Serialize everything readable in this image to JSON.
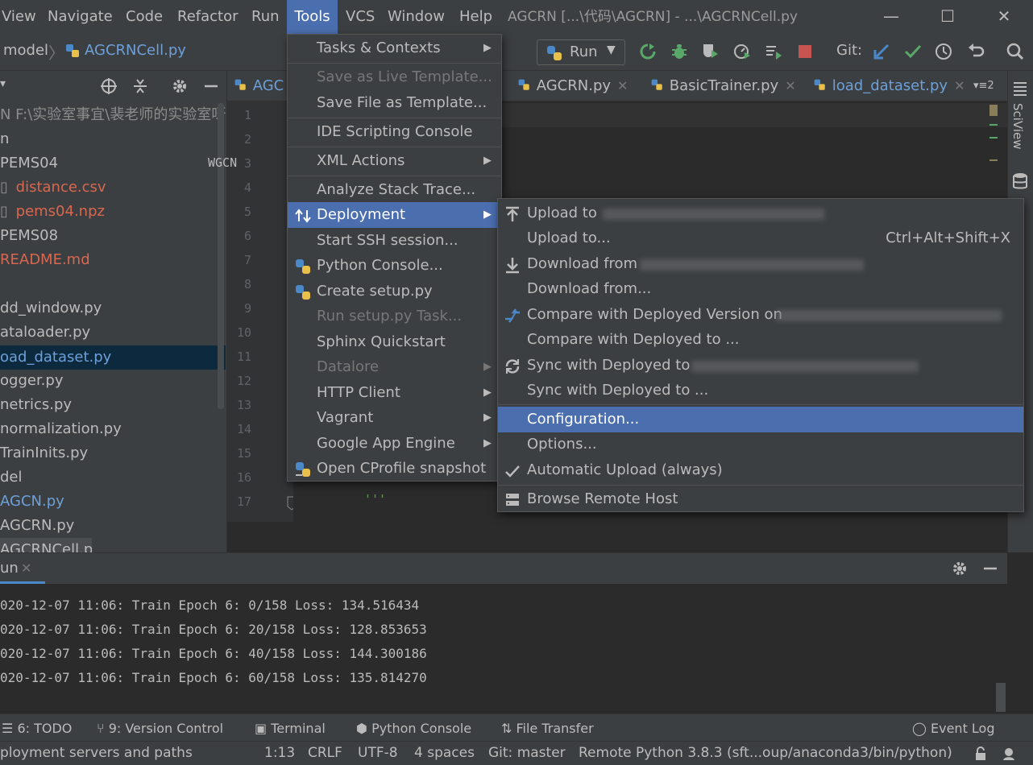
{
  "menubar": {
    "items": [
      "View",
      "Navigate",
      "Code",
      "Refactor",
      "Run",
      "Tools",
      "VCS",
      "Window",
      "Help"
    ],
    "active": "Tools",
    "window_title": "AGCRN [...\\代码\\AGCRN] - ...\\AGCRNCell.py",
    "controls": {
      "minimize": "—",
      "maximize": "☐",
      "close": "✕"
    }
  },
  "navbar": {
    "breadcrumb_model": "model",
    "breadcrumb_file": "AGCRNCell.py",
    "run_config": "Run",
    "git_label": "Git:"
  },
  "project": {
    "rows": [
      {
        "text": "N  F:\\实验室事宜\\裴老师的实验室呀\\",
        "color": "gray"
      },
      {
        "text": "n",
        "color": "def"
      },
      {
        "text": "PEMS04",
        "color": "def"
      },
      {
        "text": "distance.csv",
        "color": "red"
      },
      {
        "text": "pems04.npz",
        "color": "red"
      },
      {
        "text": "PEMS08",
        "color": "def"
      },
      {
        "text": "README.md",
        "color": "red"
      },
      {
        "text": "",
        "color": "def"
      },
      {
        "text": "dd_window.py",
        "color": "def"
      },
      {
        "text": "ataloader.py",
        "color": "def"
      },
      {
        "text": "oad_dataset.py",
        "color": "blue"
      },
      {
        "text": "ogger.py",
        "color": "def"
      },
      {
        "text": "netrics.py",
        "color": "def"
      },
      {
        "text": "normalization.py",
        "color": "def"
      },
      {
        "text": "TrainInits.py",
        "color": "def"
      },
      {
        "text": "del",
        "color": "def"
      },
      {
        "text": "AGCN.py",
        "color": "blue"
      },
      {
        "text": "AGCRN.py",
        "color": "def"
      },
      {
        "text": "AGCRNCell.py",
        "color": "def"
      }
    ]
  },
  "editor_tabs": [
    {
      "label": "AGC",
      "color": "blue"
    },
    {
      "label": "AGCRN.py",
      "color": "def"
    },
    {
      "label": "BasicTrainer.py",
      "color": "def"
    },
    {
      "label": "load_dataset.py",
      "color": "blue"
    }
  ],
  "tabs_overflow": "2",
  "line_numbers": [
    "1",
    "2",
    "3",
    "4",
    "5",
    "6",
    "7",
    "8",
    "9",
    "10",
    "11",
    "12",
    "13",
    "14",
    "15",
    "16",
    "17"
  ],
  "code": {
    "wgcn": "WGCN",
    "quote": "'''"
  },
  "sciview": "SciView",
  "tools_menu": [
    {
      "label": "Tasks & Contexts",
      "submenu": true
    },
    {
      "label": "Save as Live Template...",
      "disabled": true
    },
    {
      "label": "Save File as Template..."
    },
    {
      "label": "IDE Scripting Console"
    },
    {
      "label": "XML Actions",
      "submenu": true
    },
    {
      "label": "Analyze Stack Trace..."
    },
    {
      "label": "Deployment",
      "submenu": true,
      "highlighted": true
    },
    {
      "label": "Start SSH session..."
    },
    {
      "label": "Python Console..."
    },
    {
      "label": "Create setup.py"
    },
    {
      "label": "Run setup.py Task...",
      "disabled": true
    },
    {
      "label": "Sphinx Quickstart"
    },
    {
      "label": "Datalore",
      "submenu": true,
      "disabled": true
    },
    {
      "label": "HTTP Client",
      "submenu": true
    },
    {
      "label": "Vagrant",
      "submenu": true
    },
    {
      "label": "Google App Engine",
      "submenu": true
    },
    {
      "label": "Open CProfile snapshot"
    }
  ],
  "deploy_menu": [
    {
      "label": "Upload to",
      "icon": "upload-icon"
    },
    {
      "label": "Upload to...",
      "shortcut": "Ctrl+Alt+Shift+X"
    },
    {
      "label": "Download from",
      "icon": "download-icon"
    },
    {
      "label": "Download from..."
    },
    {
      "label": "Compare with Deployed Version on",
      "icon": "compare-icon"
    },
    {
      "label": "Compare with Deployed to ..."
    },
    {
      "label": "Sync with Deployed to",
      "icon": "sync-icon"
    },
    {
      "label": "Sync with Deployed to ..."
    },
    {
      "label": "Configuration...",
      "highlighted": true
    },
    {
      "label": "Options..."
    },
    {
      "label": "Automatic Upload (always)",
      "icon": "check-icon"
    },
    {
      "label": "Browse Remote Host",
      "icon": "server-icon"
    }
  ],
  "run_panel": {
    "tab": "un",
    "lines": [
      "020-12-07 11:06: Train Epoch 6: 0/158 Loss: 134.516434",
      "020-12-07 11:06: Train Epoch 6: 20/158 Loss: 128.853653",
      "020-12-07 11:06: Train Epoch 6: 40/158 Loss: 144.300186",
      "020-12-07 11:06: Train Epoch 6: 60/158 Loss: 135.814270"
    ]
  },
  "tool_windows": {
    "todo": "6: TODO",
    "vcs": "9: Version Control",
    "terminal": "Terminal",
    "python_console": "Python Console",
    "file_transfer": "File Transfer",
    "event_log": "Event Log"
  },
  "statusbar": {
    "message": "ployment servers and paths",
    "position": "1:13",
    "line_sep": "CRLF",
    "encoding": "UTF-8",
    "indent": "4 spaces",
    "git_branch": "Git: master",
    "interpreter": "Remote Python 3.8.3 (sft...oup/anaconda3/bin/python)"
  },
  "colors": {
    "accent": "#4b6eaf",
    "bg_dark": "#2b2b2b",
    "bg_panel": "#3c3f41",
    "text": "#bbbbbb",
    "vcs_red": "#d9674f",
    "vcs_blue": "#6d9fd8"
  }
}
